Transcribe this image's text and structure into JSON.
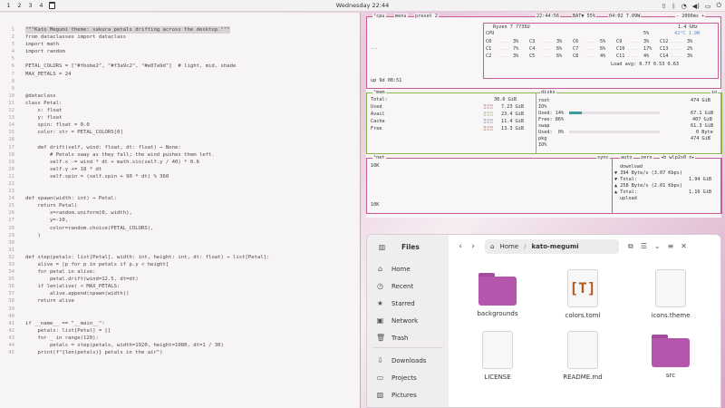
{
  "topbar": {
    "workspaces": [
      "1",
      "2",
      "3",
      "4"
    ],
    "active_workspace": "1",
    "clock": "Wednesday 22:44"
  },
  "editor": {
    "lines": [
      {
        "n": "1",
        "t": "\"\"\"Kato Megumi theme: sakura petals drifting across the desktop.\"\"\""
      },
      {
        "n": "2",
        "t": "from dataclasses import dataclass"
      },
      {
        "n": "3",
        "t": "import math"
      },
      {
        "n": "4",
        "t": "import random"
      },
      {
        "n": "5",
        "t": ""
      },
      {
        "n": "6",
        "t": "PETAL_COLORS = [\"#fbobe2\", \"#f3a9c2\", \"#e07a9d\"]  # light, mid, shade"
      },
      {
        "n": "7",
        "t": "MAX_PETALS = 24"
      },
      {
        "n": "8",
        "t": ""
      },
      {
        "n": "9",
        "t": ""
      },
      {
        "n": "10",
        "t": "@dataclass"
      },
      {
        "n": "11",
        "t": "class Petal:"
      },
      {
        "n": "12",
        "t": "    x: float"
      },
      {
        "n": "13",
        "t": "    y: float"
      },
      {
        "n": "14",
        "t": "    spin: float = 0.0"
      },
      {
        "n": "15",
        "t": "    color: str = PETAL_COLORS[0]"
      },
      {
        "n": "16",
        "t": ""
      },
      {
        "n": "17",
        "t": "    def drift(self, wind: float, dt: float) → None:"
      },
      {
        "n": "18",
        "t": "        # Petals sway as they fall; the wind pushes them left."
      },
      {
        "n": "19",
        "t": "        self.x -= wind * dt + math.sin(self.y / 40) * 0.6"
      },
      {
        "n": "20",
        "t": "        self.y += 18 * dt"
      },
      {
        "n": "21",
        "t": "        self.spin = (self.spin + 90 * dt) % 360"
      },
      {
        "n": "22",
        "t": ""
      },
      {
        "n": "23",
        "t": ""
      },
      {
        "n": "24",
        "t": "def spawn(width: int) → Petal:"
      },
      {
        "n": "25",
        "t": "    return Petal("
      },
      {
        "n": "26",
        "t": "        x=random.uniform(0, width),"
      },
      {
        "n": "27",
        "t": "        y=-10,"
      },
      {
        "n": "28",
        "t": "        color=random.choice(PETAL_COLORS),"
      },
      {
        "n": "29",
        "t": "    )"
      },
      {
        "n": "30",
        "t": ""
      },
      {
        "n": "31",
        "t": ""
      },
      {
        "n": "32",
        "t": "def step(petals: list[Petal], width: int, height: int, dt: float) → list[Petal]:"
      },
      {
        "n": "33",
        "t": "    alive = [p for p in petals if p.y < height]"
      },
      {
        "n": "34",
        "t": "    for petal in alive:"
      },
      {
        "n": "35",
        "t": "        petal.drift(wind=12.5, dt=dt)"
      },
      {
        "n": "36",
        "t": "    if len(alive) < MAX_PETALS:"
      },
      {
        "n": "37",
        "t": "        alive.append(spawn(width))"
      },
      {
        "n": "38",
        "t": "    return alive"
      },
      {
        "n": "39",
        "t": ""
      },
      {
        "n": "40",
        "t": ""
      },
      {
        "n": "41",
        "t": "if __name__ == \"__main__\":"
      },
      {
        "n": "42",
        "t": "    petals: list[Petal] = []"
      },
      {
        "n": "43",
        "t": "    for _ in range(120):"
      },
      {
        "n": "44",
        "t": "        petals = step(petals, width=1920, height=1080, dt=1 / 30)"
      },
      {
        "n": "45",
        "t": "    print(f\"{len(petals)} petals in the air\")"
      }
    ]
  },
  "btop": {
    "cpu_header": {
      "cpu": "¹cpu",
      "menu": "menu",
      "preset": "preset 2",
      "time": "22:44:56",
      "bat": "BAT▼ 55%",
      "bat_time": "04:02 7.09W",
      "interval": "- 2000ms +"
    },
    "cpu": {
      "model": "Ryzen 7 7735U",
      "freq": "1.4 GHz",
      "total_label": "CPU",
      "total_pct": "5%",
      "temp": "42°C 1.9W",
      "cores": [
        [
          "C0",
          "3%",
          "C3",
          "3%",
          "C6",
          "5%",
          "C9",
          "3%",
          "C12",
          "3%"
        ],
        [
          "C1",
          "7%",
          "C4",
          "6%",
          "C7",
          "6%",
          "C10",
          "17%",
          "C13",
          "2%"
        ],
        [
          "C2",
          "3%",
          "C5",
          "6%",
          "C8",
          "4%",
          "C11",
          "4%",
          "C14",
          "3%"
        ]
      ],
      "load": "Load avg: 0.77 0.53 0.63",
      "uptime": "up 9d 08:51"
    },
    "mem": {
      "title": "²mem",
      "total_label": "Total:",
      "total": "30.6 GiB",
      "used_label": "Used",
      "used": "7.23 GiB",
      "used_pct": 24,
      "avail_label": "Avail",
      "avail": "23.4 GiB",
      "cache_label": "Cache",
      "cache": "11.4 GiB",
      "free_label": "Free",
      "free": "13.3 GiB"
    },
    "disks": {
      "title": "disks",
      "io": "io",
      "root_label": "root",
      "root_size": "474 GiB",
      "root_io": "IO%",
      "root_used_label": "Used: 14%",
      "root_used": "67.1 GiB",
      "root_used_pct": 14,
      "root_free_label": "Free: 86%",
      "root_free": "407 GiB",
      "swap_label": "swap",
      "swap_size": "61.3 GiB",
      "swap_used_label": "Used:  0%",
      "swap_used": "0 Byte",
      "pkg_label": "pkg",
      "pkg_size": "474 GiB",
      "pkg_io": "IO%"
    },
    "net": {
      "title": "³net",
      "scale_top": "10K",
      "scale_bottom": "10K",
      "sync": "sync",
      "auto": "auto",
      "zero": "zero",
      "iface": "◂b wlp2s0 n▸",
      "download": "download",
      "dl_rate": "▼ 394 Byte/s (3.07 Kbps)",
      "dl_total_label": "▼ Total:",
      "dl_total": "1.94 GiB",
      "ul_rate": "▲ 258 Byte/s (2.01 Kbps)",
      "ul_total_label": "▲ Total:",
      "ul_total": "1.16 GiB",
      "upload": "upload"
    }
  },
  "files": {
    "title": "Files",
    "path_home": "Home",
    "path_current": "kato-megumi",
    "sidebar": [
      "Home",
      "Recent",
      "Starred",
      "Network",
      "Trash",
      "Downloads",
      "Projects",
      "Pictures"
    ],
    "items": [
      {
        "name": "backgrounds",
        "kind": "folder"
      },
      {
        "name": "colors.toml",
        "kind": "toml"
      },
      {
        "name": "icons.theme",
        "kind": "doc"
      },
      {
        "name": "LICENSE",
        "kind": "doc"
      },
      {
        "name": "README.md",
        "kind": "doc"
      },
      {
        "name": "src",
        "kind": "folder"
      }
    ]
  }
}
